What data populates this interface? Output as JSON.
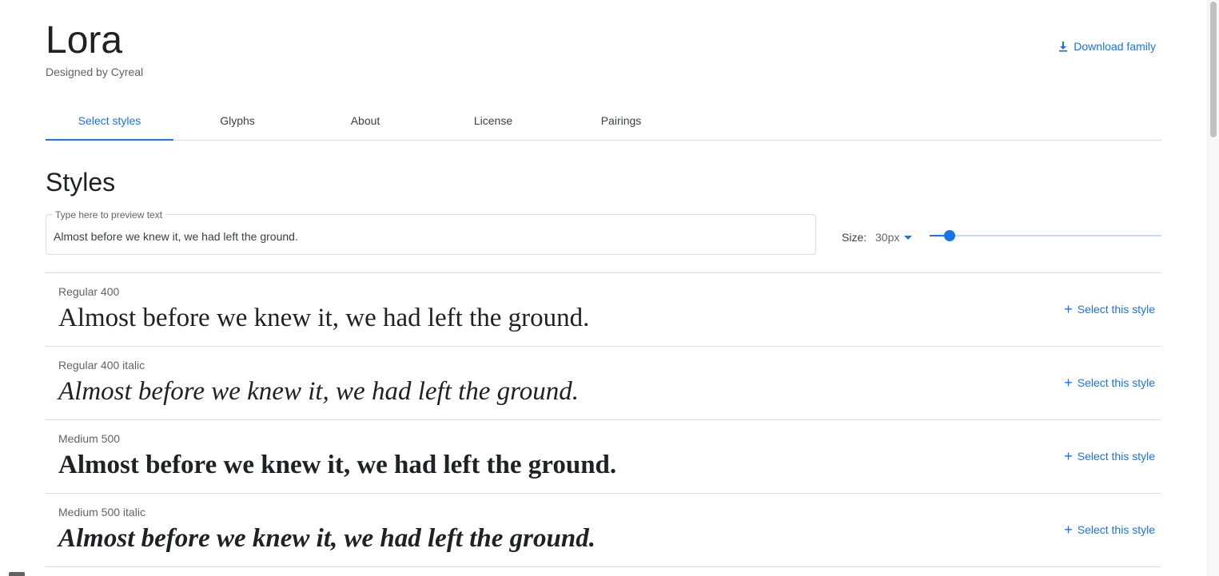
{
  "header": {
    "family_name": "Lora",
    "designer": "Designed by Cyreal",
    "download_label": "Download family"
  },
  "tabs": [
    {
      "label": "Select styles",
      "active": true
    },
    {
      "label": "Glyphs",
      "active": false
    },
    {
      "label": "About",
      "active": false
    },
    {
      "label": "License",
      "active": false
    },
    {
      "label": "Pairings",
      "active": false
    }
  ],
  "styles_section": {
    "heading": "Styles",
    "preview": {
      "placeholder": "Type here to preview text",
      "value": "Almost before we knew it, we had left the ground."
    },
    "size": {
      "label": "Size:",
      "value": "30px",
      "slider_fraction": 0.085
    },
    "select_label": "Select this style",
    "styles": [
      {
        "name": "Regular 400",
        "sample": "Almost before we knew it, we had left the ground."
      },
      {
        "name": "Regular 400 italic",
        "sample": "Almost before we knew it, we had left the ground."
      },
      {
        "name": "Medium 500",
        "sample": "Almost before we knew it, we had left the ground."
      },
      {
        "name": "Medium 500 italic",
        "sample": "Almost before we knew it, we had left the ground."
      }
    ]
  },
  "colors": {
    "accent": "#1a73e8",
    "text_primary": "#202124",
    "text_secondary": "#5f6368",
    "divider": "#dadce0"
  },
  "icons": {
    "download": "download-icon",
    "add": "plus-icon",
    "dropdown": "caret-down-icon"
  }
}
